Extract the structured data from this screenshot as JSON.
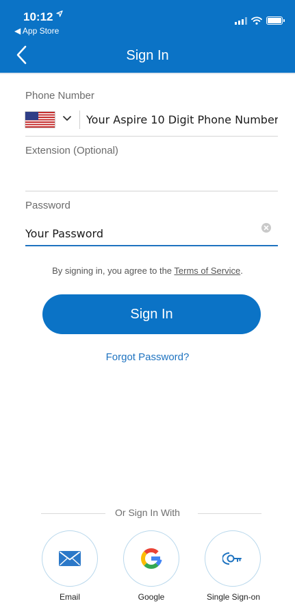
{
  "status_bar": {
    "time": "10:12",
    "back_to_app": "◀ App Store"
  },
  "header": {
    "title": "Sign In",
    "back_icon": "chevron-left-icon"
  },
  "phone": {
    "label": "Phone Number",
    "country_flag": "us-flag-icon",
    "placeholder": "Your Aspire 10 Digit Phone Number"
  },
  "extension": {
    "label": "Extension (Optional)",
    "value": ""
  },
  "password": {
    "label": "Password",
    "placeholder": "Your Password"
  },
  "terms": {
    "prefix": "By signing in, you agree to the ",
    "link": "Terms of Service",
    "suffix": "."
  },
  "actions": {
    "sign_in_label": "Sign In",
    "forgot_label": "Forgot Password?"
  },
  "social": {
    "heading": "Or Sign In With",
    "options": [
      {
        "label": "Email",
        "icon": "email-icon"
      },
      {
        "label": "Google",
        "icon": "google-icon"
      },
      {
        "label": "Single Sign-on",
        "icon": "key-icon"
      }
    ]
  },
  "colors": {
    "accent": "#0b73c6",
    "link": "#1e73c0",
    "circle_border": "#b9d8ec"
  }
}
